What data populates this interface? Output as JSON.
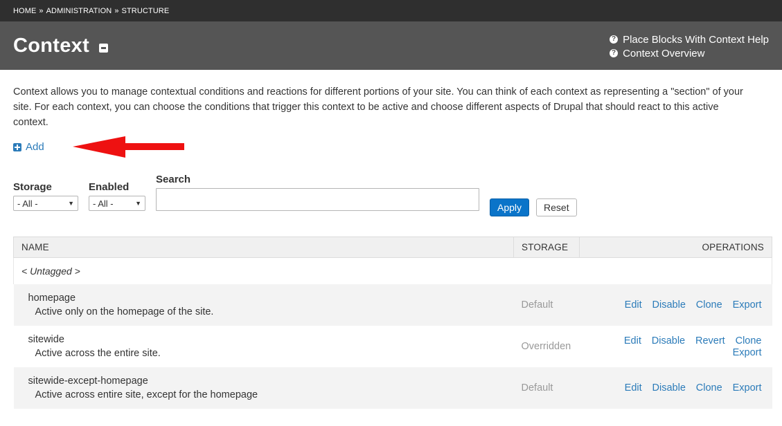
{
  "breadcrumb": {
    "items": [
      "HOME",
      "ADMINISTRATION",
      "STRUCTURE"
    ],
    "separator": "»"
  },
  "header": {
    "title": "Context",
    "help_links": [
      "Place Blocks With Context Help",
      "Context Overview"
    ]
  },
  "intro": "Context allows you to manage contextual conditions and reactions for different portions of your site. You can think of each context as representing a \"section\" of your site. For each context, you can choose the conditions that trigger this context to be active and choose different aspects of Drupal that should react to this active context.",
  "add_label": "Add",
  "filters": {
    "storage": {
      "label": "Storage",
      "value": "- All -"
    },
    "enabled": {
      "label": "Enabled",
      "value": "- All -"
    },
    "search": {
      "label": "Search",
      "value": ""
    },
    "apply_label": "Apply",
    "reset_label": "Reset"
  },
  "table": {
    "headers": {
      "name": "NAME",
      "storage": "STORAGE",
      "operations": "OPERATIONS"
    },
    "group": "< Untagged >",
    "rows": [
      {
        "name": "homepage",
        "description": "Active only on the homepage of the site.",
        "storage": "Default",
        "operations": [
          "Edit",
          "Disable",
          "Clone",
          "Export"
        ]
      },
      {
        "name": "sitewide",
        "description": "Active across the entire site.",
        "storage": "Overridden",
        "operations": [
          "Edit",
          "Disable",
          "Revert",
          "Clone",
          "Export"
        ]
      },
      {
        "name": "sitewide-except-homepage",
        "description": "Active across entire site, except for the homepage",
        "storage": "Default",
        "operations": [
          "Edit",
          "Disable",
          "Clone",
          "Export"
        ]
      }
    ]
  },
  "colors": {
    "topbar": "#2f2f2f",
    "titlebar": "#555555",
    "link": "#2b7bb9",
    "apply_button": "#0a74c9",
    "annotation_arrow": "#ee1111"
  }
}
